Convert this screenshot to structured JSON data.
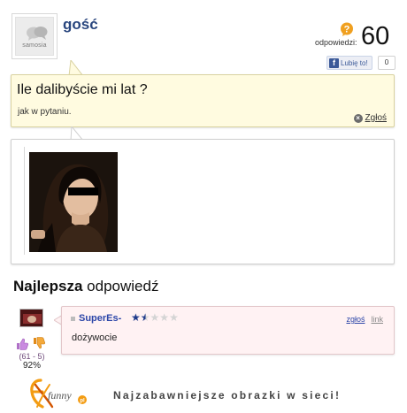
{
  "header": {
    "avatar_caption": "samosia",
    "username": "gość",
    "answers_label": "odpowiedzi:",
    "answers_count": "60",
    "like_label": "Lubię to!",
    "like_count": "0"
  },
  "question": {
    "title": "Ile dalibyście mi lat ?",
    "body": "jak w pytaniu.",
    "report_label": "Zgłoś"
  },
  "best_answer": {
    "title_bold": "Najlepsza",
    "title_rest": " odpowiedź",
    "user": "SuperEs-",
    "rating_stars": 1.5,
    "rating_max": 5,
    "report_label": "zgłoś",
    "link_label": "link",
    "text": "dożywocie",
    "votes": "(61 - 5)",
    "percent": "92%"
  },
  "footer": {
    "logo_text": "funny",
    "tagline": "Najzabawniejsze obrazki w sieci!"
  },
  "colors": {
    "username": "#29467e",
    "question_bg": "#fffbe0",
    "answer_bg": "#fff2f3",
    "answer_user": "#2c46a8",
    "logo_orange": "#f39c12"
  }
}
